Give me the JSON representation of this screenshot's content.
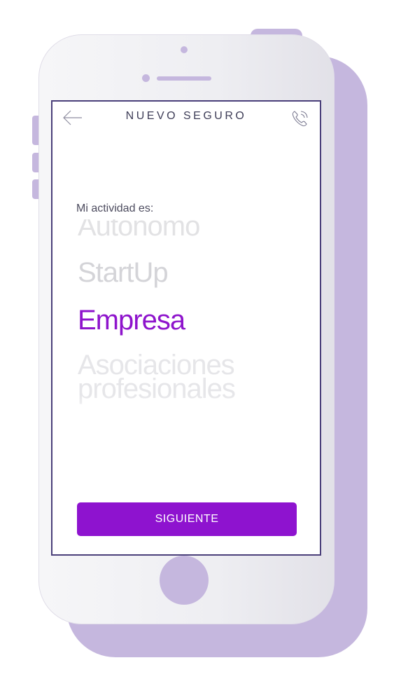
{
  "header": {
    "title": "NUEVO SEGURO",
    "back_icon": "arrow-left-icon",
    "call_icon": "phone-call-icon"
  },
  "form": {
    "label": "Mi actividad es:",
    "options": [
      "Autonomo",
      "StartUp",
      "Empresa",
      "Asociaciones",
      "profesionales"
    ],
    "selected": "Empresa"
  },
  "footer": {
    "next_label": "SIGUIENTE"
  },
  "colors": {
    "accent": "#8e13cf",
    "device_accent": "#c5b7de",
    "screen_border": "#4a3f7a",
    "title_text": "#3e3d57"
  }
}
